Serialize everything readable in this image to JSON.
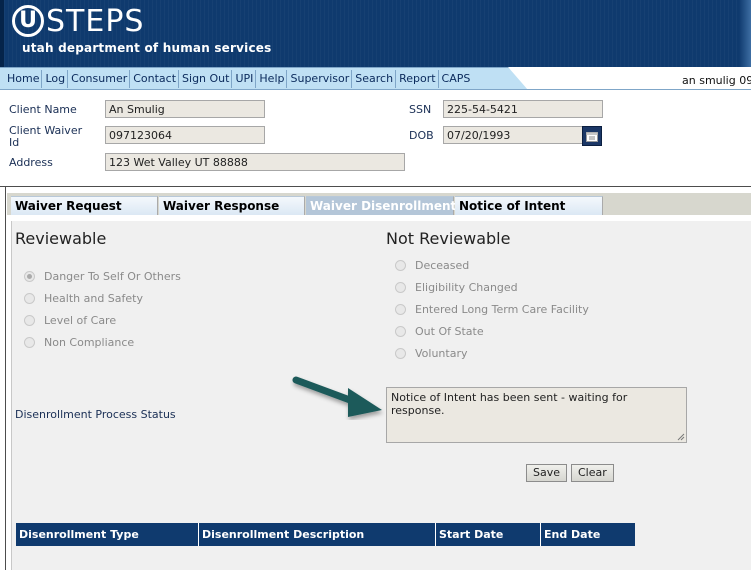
{
  "brand": {
    "logo_letter": "U",
    "logo_text": "STEPS",
    "subtitle": "utah department of human services"
  },
  "nav": {
    "items": [
      "Home",
      "Log",
      "Consumer",
      "Contact",
      "Sign Out",
      "UPI",
      "Help",
      "Supervisor",
      "Search",
      "Report",
      "CAPS"
    ],
    "user": "an smulig 09"
  },
  "client": {
    "name_label": "Client Name",
    "name_value": "An Smulig",
    "waiver_label_1": "Client Waiver",
    "waiver_label_2": "Id",
    "waiver_value": "097123064",
    "address_label": "Address",
    "address_value": "123 Wet Valley UT 88888",
    "ssn_label": "SSN",
    "ssn_value": "225-54-5421",
    "dob_label": "DOB",
    "dob_value": "07/20/1993"
  },
  "tabs": [
    {
      "label": "Waiver Request",
      "active": false
    },
    {
      "label": "Waiver Response",
      "active": false
    },
    {
      "label": "Waiver Disenrollment",
      "active": true
    },
    {
      "label": "Notice of Intent",
      "active": false
    }
  ],
  "reviewable": {
    "title": "Reviewable",
    "options": [
      {
        "label": "Danger To Self Or Others",
        "checked": true
      },
      {
        "label": "Health and Safety",
        "checked": false
      },
      {
        "label": "Level of Care",
        "checked": false
      },
      {
        "label": "Non Compliance",
        "checked": false
      }
    ]
  },
  "not_reviewable": {
    "title": "Not Reviewable",
    "options": [
      {
        "label": "Deceased",
        "checked": false
      },
      {
        "label": "Eligibility Changed",
        "checked": false
      },
      {
        "label": "Entered Long Term Care Facility",
        "checked": false
      },
      {
        "label": "Out Of State",
        "checked": false
      },
      {
        "label": "Voluntary",
        "checked": false
      }
    ]
  },
  "status": {
    "label": "Disenrollment Process Status",
    "value": "Notice of Intent has been sent - waiting for response."
  },
  "buttons": {
    "save": "Save",
    "clear": "Clear"
  },
  "table": {
    "columns": [
      "Disenrollment Type",
      "Disenrollment Description",
      "Start Date",
      "End Date"
    ]
  },
  "colors": {
    "header_blue": "#0f3a6e",
    "nav_blue": "#bfe0f4",
    "active_tab": "#b4c6d8",
    "arrow_teal": "#1d5a5a"
  }
}
